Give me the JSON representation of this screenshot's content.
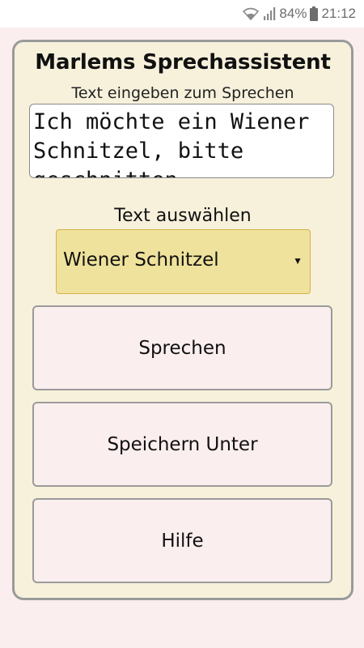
{
  "status_bar": {
    "battery_percent": "84%",
    "time": "21:12",
    "icons": [
      "wifi-icon",
      "signal-icon",
      "battery-icon"
    ]
  },
  "app": {
    "title": "Marlems Sprechassistent",
    "input_label": "Text eingeben zum Sprechen",
    "input_value": "Ich möchte ein Wiener Schnitzel, bitte geschnitten",
    "select_label": "Text auswählen",
    "select_value": "Wiener Schnitzel",
    "buttons": {
      "speak": "Sprechen",
      "save_as": "Speichern Unter",
      "help": "Hilfe"
    }
  },
  "colors": {
    "background": "#fbeeee",
    "panel": "#f7f1dc",
    "select_fill": "#efe29c",
    "select_border": "#d4b24a"
  }
}
